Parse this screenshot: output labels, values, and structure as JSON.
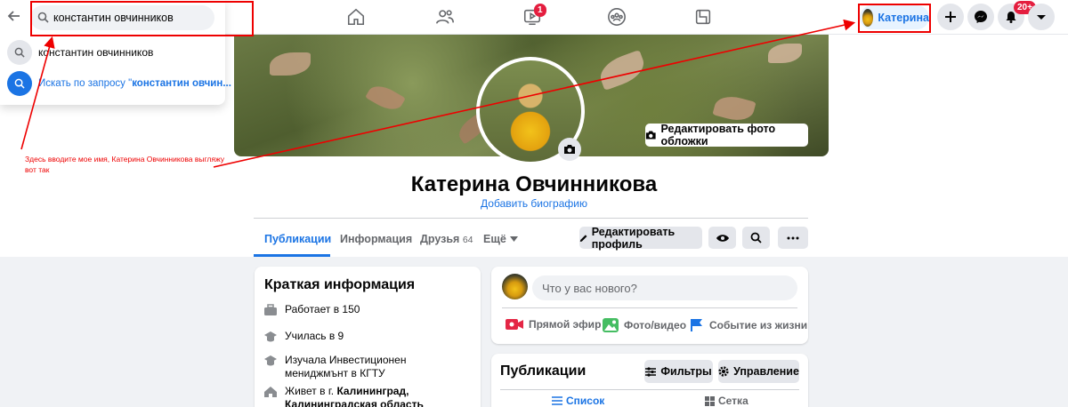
{
  "search": {
    "query": "константин овчинников",
    "suggestion": "константин овчинников",
    "search_for_prefix": "Искать по запросу \"",
    "search_for_query": "константин овчин..."
  },
  "nav": {
    "video_badge": "1",
    "notifications_badge": "20+",
    "profile_name": "Катерина"
  },
  "annotation": {
    "text": "Здесь вводите мое имя, Катерина Овчинникова выгляжу вот так"
  },
  "cover": {
    "edit_label": "Редактировать фото обложки"
  },
  "profile": {
    "name": "Катерина Овчинникова",
    "add_bio": "Добавить биографию"
  },
  "tabs": {
    "posts": "Публикации",
    "about": "Информация",
    "friends": "Друзья",
    "friends_count": "64",
    "more": "Ещё"
  },
  "actions": {
    "edit_profile": "Редактировать профиль"
  },
  "intro": {
    "title": "Краткая информация",
    "work": "Работает в 150",
    "school": "Училась в 9",
    "studied": "Изучала Инвестиционен мениджмънт в КГТУ",
    "lives_prefix": "Живет в г.",
    "lives_city": "Калининград,",
    "lives_region": "Калининградская область"
  },
  "composer": {
    "placeholder": "Что у вас нового?",
    "live": "Прямой эфир",
    "photo": "Фото/видео",
    "life_event": "Событие из жизни"
  },
  "posts": {
    "title": "Публикации",
    "filters": "Фильтры",
    "manage": "Управление",
    "list_view": "Список",
    "grid_view": "Сетка"
  },
  "colors": {
    "accent": "#1b74e4",
    "annotation_red": "#e00000",
    "badge_red": "#e41e3f"
  }
}
